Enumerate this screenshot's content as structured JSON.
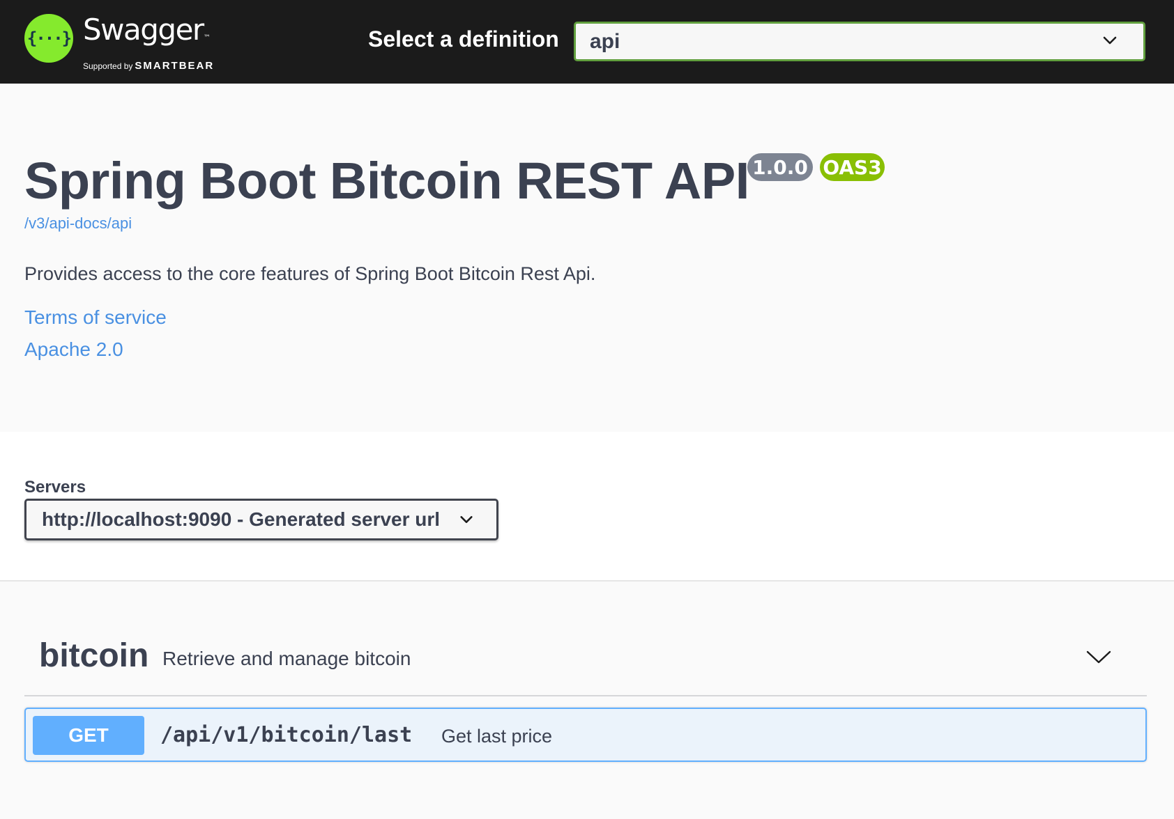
{
  "topbar": {
    "logo_text": "Swagger",
    "logo_tm": "™",
    "supported_by": "Supported by",
    "brand": "SMARTBEAR",
    "logo_glyph": "{···}",
    "definition_label": "Select a definition",
    "definition_value": "api"
  },
  "info": {
    "title": "Spring Boot Bitcoin REST API",
    "version_badge": "1.0.0",
    "oas_badge": "OAS3",
    "doc_link": "/v3/api-docs/api",
    "description": "Provides access to the core features of Spring Boot Bitcoin Rest Api.",
    "terms_link": "Terms of service",
    "license_link": "Apache 2.0"
  },
  "servers": {
    "label": "Servers",
    "selected": "http://localhost:9090 - Generated server url"
  },
  "tags": [
    {
      "name": "bitcoin",
      "description": "Retrieve and manage bitcoin",
      "operations": [
        {
          "method": "GET",
          "path": "/api/v1/bitcoin/last",
          "summary": "Get last price"
        }
      ]
    }
  ],
  "colors": {
    "topbar_bg": "#1b1b1b",
    "accent_green": "#85ea2d",
    "select_border": "#62a03f",
    "version_badge": "#7d8492",
    "oas_badge": "#89bf04",
    "link": "#4990e2",
    "get_method": "#61affe",
    "get_bg": "#ebf3fb"
  },
  "icons": {
    "definition_chevron": "chevron-down-icon",
    "servers_chevron": "chevron-down-icon",
    "tag_chevron": "chevron-down-icon"
  }
}
